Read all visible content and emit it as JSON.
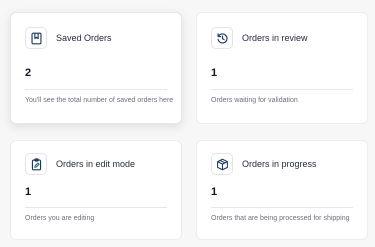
{
  "cards": [
    {
      "icon": "bookmark-icon",
      "title": "Saved Orders",
      "value": "2",
      "description": "You'll see the total number of saved orders here"
    },
    {
      "icon": "refresh-icon",
      "title": "Orders in review",
      "value": "1",
      "description": "Orders waiting for validation"
    },
    {
      "icon": "clipboard-edit-icon",
      "title": "Orders in edit mode",
      "value": "1",
      "description": "Orders you are editing"
    },
    {
      "icon": "box-icon",
      "title": "Orders in progress",
      "value": "1",
      "description": "Orders that are being processed for shipping"
    }
  ],
  "colors": {
    "icon": "#1f3a5f",
    "accent": "#2f7d6d",
    "muted": "#6b7280"
  }
}
